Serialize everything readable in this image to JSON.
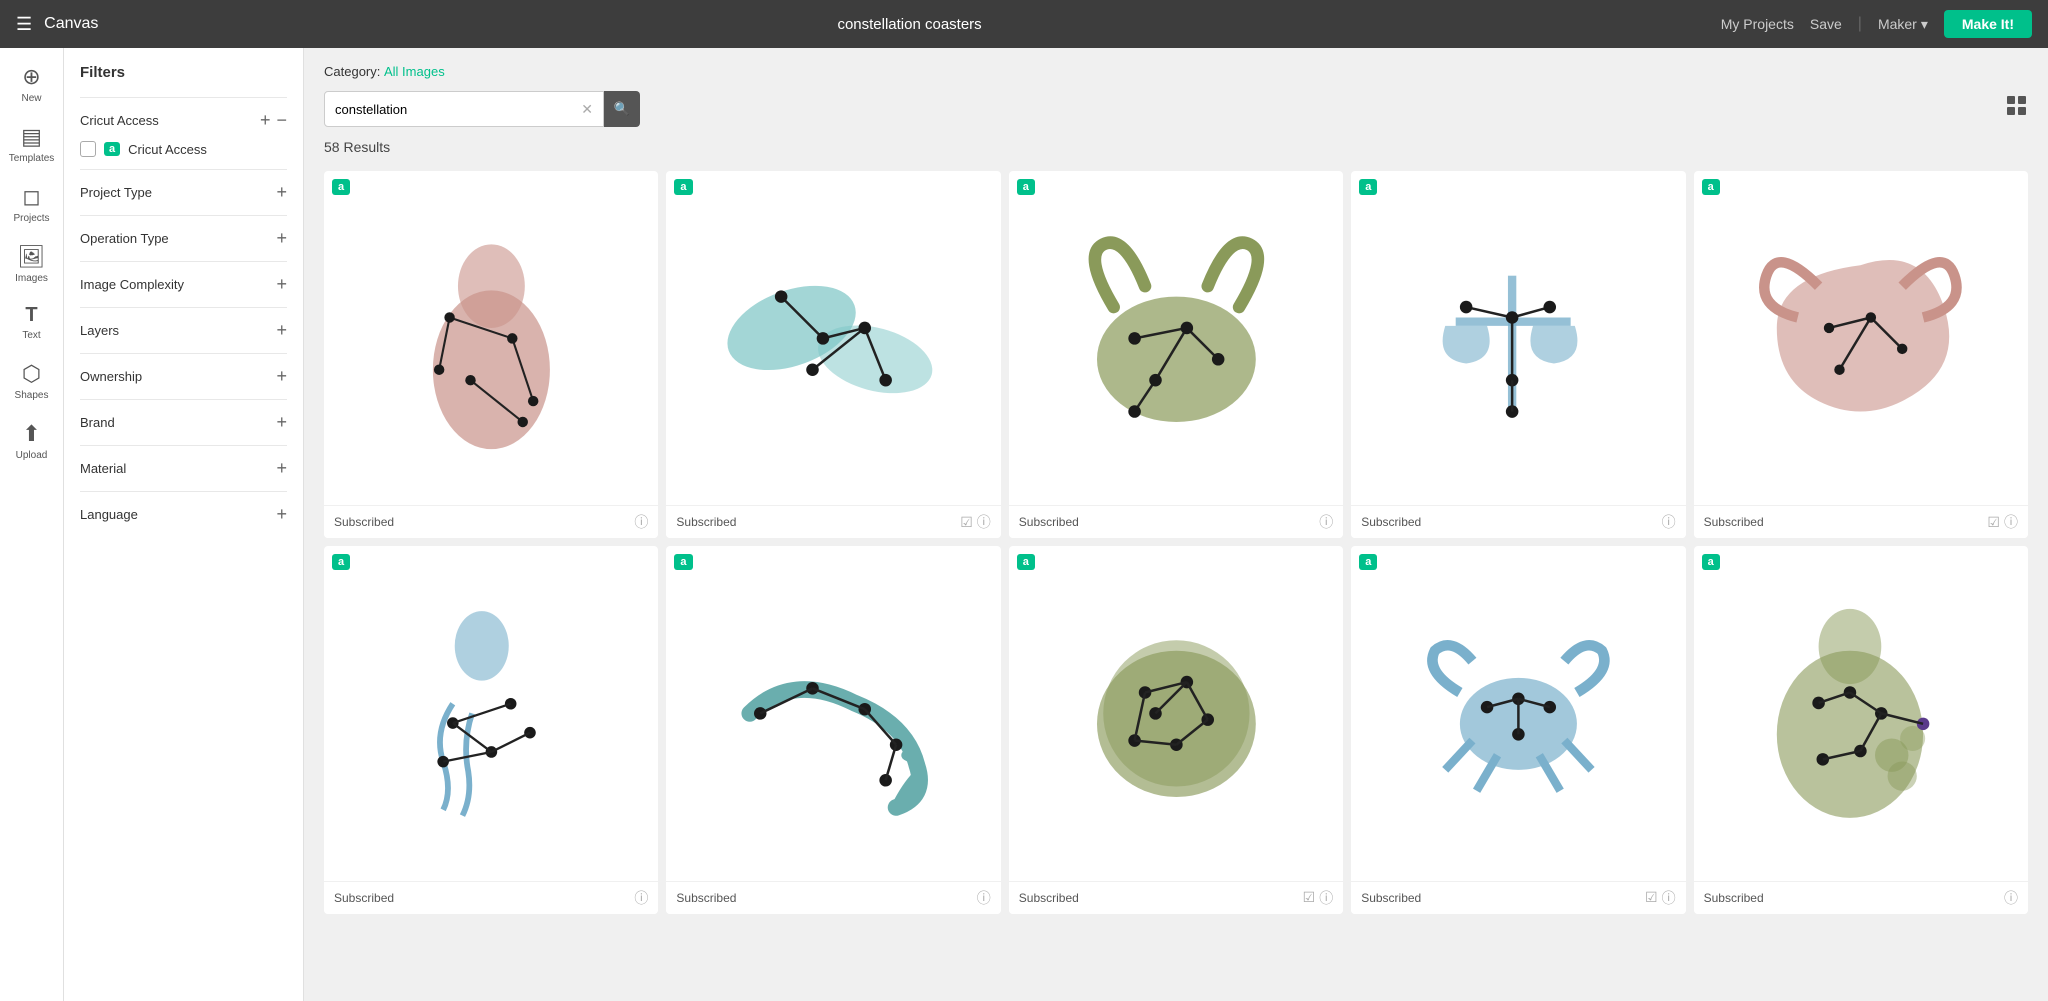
{
  "topNav": {
    "appTitle": "Canvas",
    "pageTitle": "constellation coasters",
    "myProjects": "My Projects",
    "save": "Save",
    "sep": "|",
    "maker": "Maker",
    "makeIt": "Make It!"
  },
  "iconSidebar": {
    "items": [
      {
        "id": "new",
        "icon": "+",
        "label": "New"
      },
      {
        "id": "templates",
        "icon": "☰",
        "label": "Templates"
      },
      {
        "id": "projects",
        "icon": "◻",
        "label": "Projects"
      },
      {
        "id": "images",
        "icon": "🖼",
        "label": "Images"
      },
      {
        "id": "text",
        "icon": "T",
        "label": "Text"
      },
      {
        "id": "shapes",
        "icon": "⬡",
        "label": "Shapes"
      },
      {
        "id": "upload",
        "icon": "↑",
        "label": "Upload"
      }
    ]
  },
  "filters": {
    "title": "Filters",
    "sections": [
      {
        "id": "cricut-access",
        "label": "Cricut Access",
        "expanded": true,
        "hasCheckbox": true,
        "checkboxLabel": "Cricut Access"
      },
      {
        "id": "project-type",
        "label": "Project Type",
        "expanded": false
      },
      {
        "id": "operation-type",
        "label": "Operation Type",
        "expanded": false
      },
      {
        "id": "image-complexity",
        "label": "Image Complexity",
        "expanded": false
      },
      {
        "id": "layers",
        "label": "Layers",
        "expanded": false
      },
      {
        "id": "ownership",
        "label": "Ownership",
        "expanded": false
      },
      {
        "id": "brand",
        "label": "Brand",
        "expanded": false
      },
      {
        "id": "material",
        "label": "Material",
        "expanded": false
      },
      {
        "id": "language",
        "label": "Language",
        "expanded": false
      }
    ]
  },
  "content": {
    "categoryLabel": "Category:",
    "categoryValue": "All Images",
    "searchPlaceholder": "constellation",
    "searchValue": "constellation",
    "resultsCount": "58 Results",
    "images": [
      {
        "id": 1,
        "label": "Subscribed",
        "hasCheck": false,
        "zodiac": "virgo",
        "color": "#b87878"
      },
      {
        "id": 2,
        "label": "Subscribed",
        "hasCheck": true,
        "zodiac": "pisces",
        "color": "#6aaeae"
      },
      {
        "id": 3,
        "label": "Subscribed",
        "hasCheck": false,
        "zodiac": "taurus",
        "color": "#8a9a5a"
      },
      {
        "id": 4,
        "label": "Subscribed",
        "hasCheck": false,
        "zodiac": "libra",
        "color": "#7ab0cc"
      },
      {
        "id": 5,
        "label": "Subscribed",
        "hasCheck": true,
        "zodiac": "aries",
        "color": "#b87878"
      },
      {
        "id": 6,
        "label": "Subscribed",
        "hasCheck": false,
        "zodiac": "aquarius",
        "color": "#7ab0cc"
      },
      {
        "id": 7,
        "label": "Subscribed",
        "hasCheck": false,
        "zodiac": "scorpio",
        "color": "#6aaeae"
      },
      {
        "id": 8,
        "label": "Subscribed",
        "hasCheck": true,
        "zodiac": "cancer",
        "color": "#8a9a5a"
      },
      {
        "id": 9,
        "label": "Subscribed",
        "hasCheck": true,
        "zodiac": "crab",
        "color": "#7ab0cc"
      },
      {
        "id": 10,
        "label": "Subscribed",
        "hasCheck": false,
        "zodiac": "virgo2",
        "color": "#8a9a5a"
      }
    ],
    "badgeLabel": "a"
  }
}
